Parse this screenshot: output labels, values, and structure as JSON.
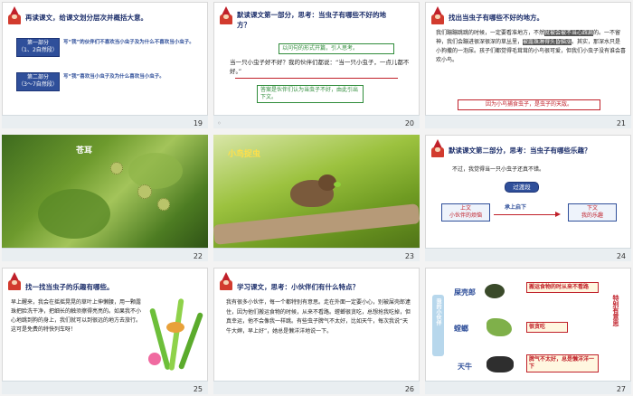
{
  "slides": [
    {
      "number": "19",
      "title": "再读课文，给课文划分层次并概括大意。",
      "sections": [
        {
          "label": "第一部分\n（1、2自然段）",
          "text": "写“我”的伙伴们不喜欢当小虫子及为什么不喜欢当小虫子。"
        },
        {
          "label": "第二部分\n（3～7自然段）",
          "text": "写“我”喜欢当小虫子及为什么喜欢当小虫子。"
        }
      ]
    },
    {
      "number": "20",
      "title": "默读课文第一部分，思考：当虫子有哪些不好的地方？",
      "note1": "以问句的形式开篇，引人思考。",
      "para": "当一只小虫子好不好？我的伙伴们都说：“当一只小虫子，一点儿都不好。”",
      "note2": "答案是伙伴们认为当虫子不好，由此引出下文。"
    },
    {
      "number": "21",
      "title": "找出当虫子有哪些不好的地方。",
      "para_parts": [
        "我们蹦蹦跳跳的时候，一定要看准地方，不然",
        "就被会被不当心踩扁",
        "的。一不留神，我们会蹦进很深很深的草丛里，",
        "被露珠淋得头昏脑涨",
        "。其实，那深水只是小狗撒的一泡尿。孩子们都觉得毛茸茸的小鸟很可爱，但我们小虫子没有谁会喜欢小鸟。"
      ],
      "conclusion": "因为小鸟捕食虫子，是虫子的天敌。"
    },
    {
      "number": "22",
      "caption": "苍耳"
    },
    {
      "number": "23",
      "caption": "小鸟捉虫"
    },
    {
      "number": "24",
      "title": "默读课文第二部分，思考：当虫子有哪些乐趣？",
      "para": "不过，我觉得当一只小虫子还真不错。",
      "transition": "过渡段",
      "left_box": "上文\n小伙伴的烦恼",
      "arrow_label": "承上启下",
      "right_box": "下文\n我的乐趣"
    },
    {
      "number": "25",
      "title": "找一找当虫子的乐趣有哪些。",
      "para": "早上醒来，我会在摇摇晃晃的草叶上伸懒腰，用一颗露珠把脸洗干净，把细长的触须擦得亮亮的。如果我不小心地跳到狗的身上，我们就可以到很远的地方去旅行。这可是免费的特快列车呀！"
    },
    {
      "number": "26",
      "title": "学习课文，思考：小伙伴们有什么特点？",
      "para": "我有很多小伙伴，每一个都特别有意思。走在外面一定要小心，别被屎壳郎逮住，因为他们搬运食物的时候，从来不看路。螳螂很贪吃，总想抢我吃掉，但真幸运，他不会像我一样跳。有些虫子脾气不太好，比如天牛，每次我说“天牛大婶，早上好”，她总是懒洋洋地说一下。"
    },
    {
      "number": "27",
      "side_label": "我的小伙伴",
      "right_vertical": "特别有意思",
      "items": [
        {
          "name": "屎壳郎",
          "trait": "搬运食物的时从来不看路"
        },
        {
          "name": "螳螂",
          "trait": "很贪吃"
        },
        {
          "name": "天牛",
          "trait": "脾气不太好，总是懒洋洋一下"
        }
      ]
    }
  ]
}
